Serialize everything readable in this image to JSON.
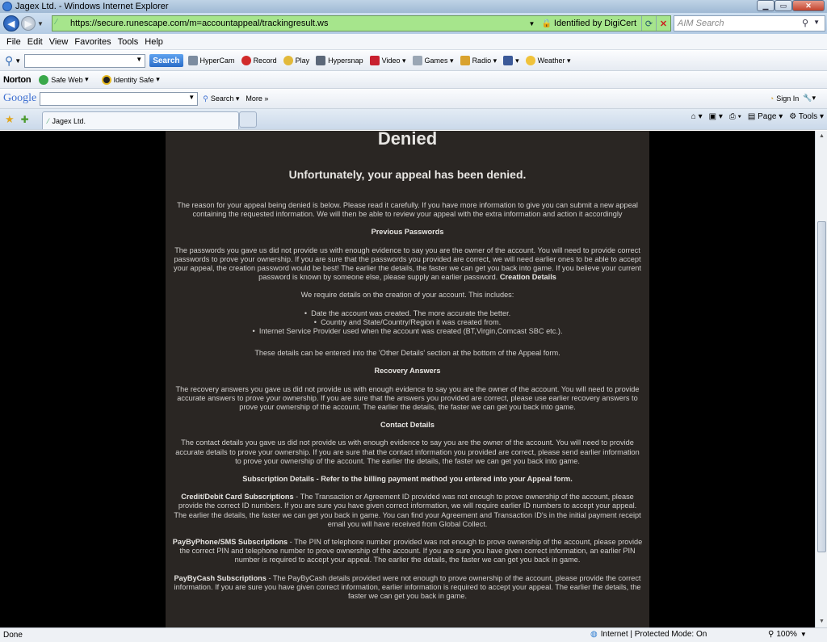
{
  "window": {
    "title": "Jagex Ltd. - Windows Internet Explorer"
  },
  "address": {
    "url": "https://secure.runescape.com/m=accountappeal/trackingresult.ws",
    "identity": "Identified by DigiCert",
    "search_placeholder": "AIM Search"
  },
  "menu": [
    "File",
    "Edit",
    "View",
    "Favorites",
    "Tools",
    "Help"
  ],
  "toolbar1": {
    "search": "Search",
    "items": [
      "HyperCam",
      "Record",
      "Play",
      "Hypersnap",
      "Video",
      "Games",
      "Radio",
      "Weather"
    ]
  },
  "toolbar2": {
    "brand": "Norton",
    "items": [
      "Safe Web",
      "Identity Safe"
    ]
  },
  "toolbar3": {
    "brand": "Google",
    "search": "Search",
    "more": "More",
    "signin": "Sign In"
  },
  "tabs": {
    "active": "Jagex Ltd.",
    "page": "Page",
    "tools": "Tools"
  },
  "page": {
    "heading": "Denied",
    "subheading": "Unfortunately, your appeal has been denied.",
    "intro": "The reason for your appeal being denied is below. Please read it carefully. If you have more information to give you can submit a new appeal containing the requested information. We will then be able to review your appeal with the extra information and action it accordingly",
    "passwords_title": "Previous Passwords",
    "passwords_text": "The passwords you gave us did not provide us with enough evidence to say you are the owner of the account. You will need to provide correct passwords to prove your ownership. If you are sure that the passwords you provided are correct, we will need earlier ones to be able to accept your appeal, the creation password would be best! The earlier the details, the faster we can get you back into game. If you believe your current password is known by someone else, please supply an earlier password.",
    "creation_title": "Creation Details",
    "creation_text": "We require details on the creation of your account. This includes:",
    "creation_items": [
      "Date the account was created. The more accurate the better.",
      "Country and State/Country/Region it was created from.",
      "Internet Service Provider used when the account was created (BT,Virgin,Comcast SBC etc.)."
    ],
    "creation_note": "These details can be entered into the 'Other Details' section at the bottom of the Appeal form.",
    "recovery_title": "Recovery Answers",
    "recovery_text": "The recovery answers you gave us did not provide us with enough evidence to say you are the owner of the account. You will need to provide accurate answers to prove your ownership. If you are sure that the answers you provided are correct, please use earlier recovery answers to prove your ownership of the account. The earlier the details, the faster we can get you back into game.",
    "contact_title": "Contact Details",
    "contact_text": "The contact details you gave us did not provide us with enough evidence to say you are the owner of the account. You will need to provide accurate details to prove your ownership. If you are sure that the contact information you provided are correct, please send earlier information to prove your ownership of the account. The earlier the details, the faster we can get you back into game.",
    "subscription_title": "Subscription Details - Refer to the billing payment method you entered into your Appeal form.",
    "card_title": "Credit/Debit Card Subscriptions",
    "card_text": " - The Transaction or Agreement ID provided was not enough to prove ownership of the account, please provide the correct ID numbers. If you are sure you have given correct information, we will require earlier ID numbers to accept your appeal. The earlier the details, the faster we can get you back in game. You can find your Agreement and Transaction ID's in the initial payment receipt email you will have received from Global Collect.",
    "phone_title": "PayByPhone/SMS Subscriptions",
    "phone_text": " - The PIN of telephone number provided was not enough to prove ownership of the account, please provide the correct PIN and telephone number to prove ownership of the account. If you are sure you have given correct information, an earlier PIN number is required to accept your appeal. The earlier the details, the faster we can get you back in game.",
    "cash_title": "PayByCash Subscriptions",
    "cash_text": " - The PayByCash details provided were not enough to prove ownership of the account, please provide the correct information. If you are sure you have given correct information, earlier information is required to accept your appeal. The earlier the details, the faster we can get you back in game."
  },
  "status": {
    "left": "Done",
    "zone": "Internet | Protected Mode: On",
    "zoom": "100%"
  }
}
